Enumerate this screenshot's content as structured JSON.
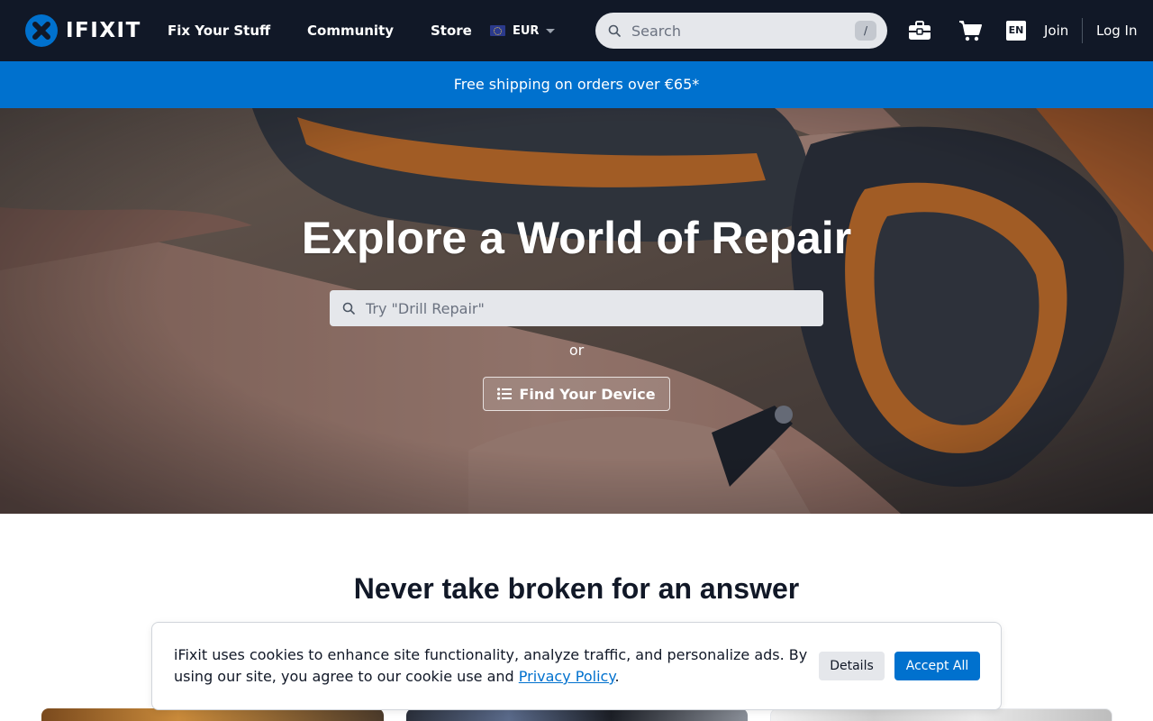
{
  "header": {
    "logo_text": "IFIXIT",
    "nav": {
      "fix_your_stuff": "Fix Your Stuff",
      "community": "Community",
      "store": "Store"
    },
    "currency": "EUR",
    "search": {
      "placeholder": "Search",
      "shortcut": "/"
    },
    "language": "EN",
    "join": "Join",
    "login": "Log In"
  },
  "promo": {
    "text": "Free shipping on orders over €65*"
  },
  "hero": {
    "title": "Explore a World of Repair",
    "search_placeholder": "Try \"Drill Repair\"",
    "or_text": "or",
    "find_device_label": "Find Your Device"
  },
  "section": {
    "title": "Never take broken for an answer"
  },
  "cookie_banner": {
    "text_before_link": "iFixit uses cookies to enhance site functionality, analyze traffic, and personalize ads. By using our site, you agree to our cookie use and ",
    "link_text": "Privacy Policy",
    "text_after_link": ".",
    "details_label": "Details",
    "accept_label": "Accept All"
  },
  "colors": {
    "header_bg": "#111827",
    "brand_blue": "#0071ce",
    "search_bg": "#e5e7eb"
  },
  "icons": [
    "ifixit-logo-icon",
    "eu-flag-icon",
    "chevron-down-icon",
    "search-icon",
    "toolbox-icon",
    "cart-icon",
    "list-icon"
  ]
}
